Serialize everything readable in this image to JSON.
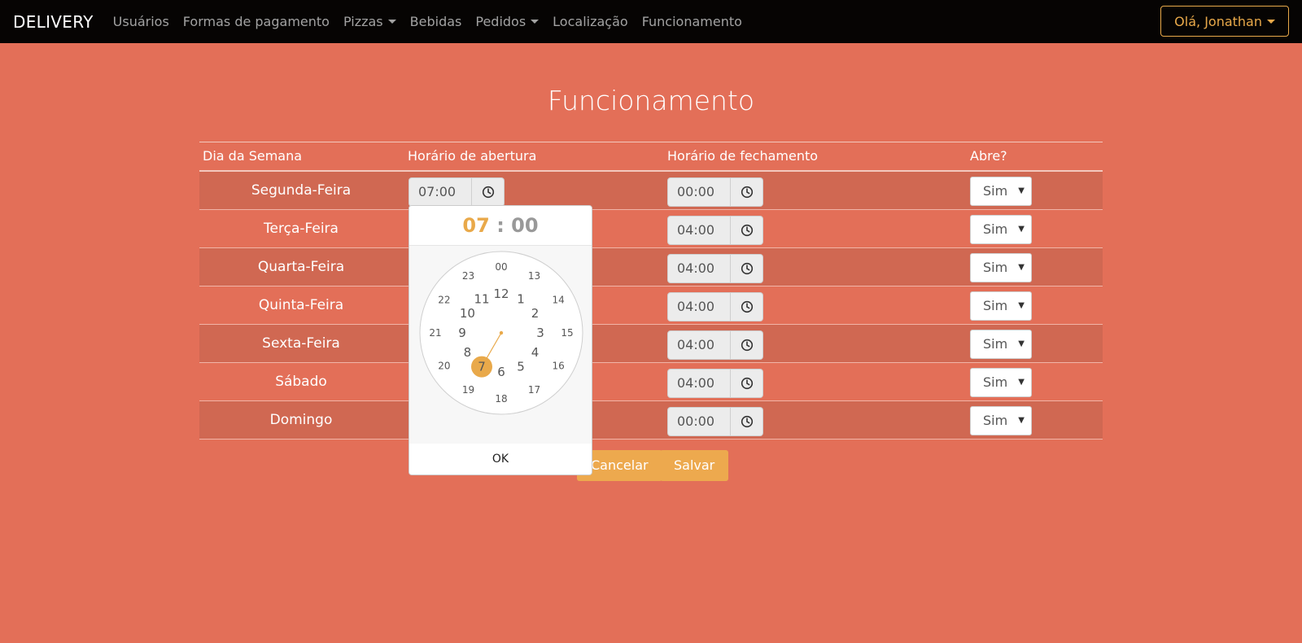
{
  "nav": {
    "brand": "DELIVERY",
    "items": [
      "Usuários",
      "Formas de pagamento",
      "Pizzas",
      "Bebidas",
      "Pedidos",
      "Localização",
      "Funcionamento"
    ],
    "user": "Olá, Jonathan"
  },
  "page": {
    "title": "Funcionamento"
  },
  "table": {
    "headers": [
      "Dia da Semana",
      "Horário de abertura",
      "Horário de fechamento",
      "Abre?"
    ],
    "rows": [
      {
        "day": "Segunda-Feira",
        "open": "07:00",
        "close": "00:00",
        "opens": "Sim"
      },
      {
        "day": "Terça-Feira",
        "close": "04:00",
        "opens": "Sim"
      },
      {
        "day": "Quarta-Feira",
        "close": "04:00",
        "opens": "Sim"
      },
      {
        "day": "Quinta-Feira",
        "close": "04:00",
        "opens": "Sim"
      },
      {
        "day": "Sexta-Feira",
        "close": "04:00",
        "opens": "Sim"
      },
      {
        "day": "Sábado",
        "close": "04:00",
        "opens": "Sim"
      },
      {
        "day": "Domingo",
        "close": "00:00",
        "opens": "Sim"
      }
    ]
  },
  "buttons": {
    "cancel": "Cancelar",
    "save": "Salvar"
  },
  "picker": {
    "hour": "07",
    "sep": ":",
    "minute": "00",
    "inner_hours": [
      "12",
      "1",
      "2",
      "3",
      "4",
      "5",
      "6",
      "7",
      "8",
      "9",
      "10",
      "11"
    ],
    "outer_hours": [
      "00",
      "13",
      "14",
      "15",
      "16",
      "17",
      "18",
      "19",
      "20",
      "21",
      "22",
      "23"
    ],
    "selected": "7",
    "ok": "OK"
  },
  "colors": {
    "background": "#e36f58",
    "accent": "#eda94e",
    "navbar": "#060403"
  }
}
